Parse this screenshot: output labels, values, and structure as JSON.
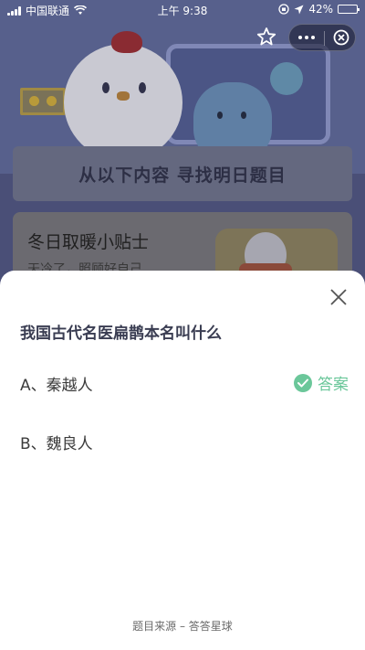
{
  "status_bar": {
    "carrier": "中国联通",
    "time": "上午 9:38",
    "battery": "42%",
    "battery_level": 0.42
  },
  "background": {
    "banner_text": "从以下内容  寻找明日题目",
    "card_title": "冬日取暖小贴士",
    "card_subtitle": "天冷了，照顾好自己"
  },
  "top_controls": {
    "favorite_icon": "star-outline-icon",
    "more_icon": "more-dots-icon",
    "close_icon": "circle-close-icon"
  },
  "sheet": {
    "question": "我国古代名医扁鹊本名叫什么",
    "options": [
      {
        "label": "A、秦越人",
        "is_answer": true
      },
      {
        "label": "B、魏良人",
        "is_answer": false
      }
    ],
    "answer_label": "答案",
    "source": "题目来源 – 答答星球",
    "accent_color": "#6bc79a"
  }
}
